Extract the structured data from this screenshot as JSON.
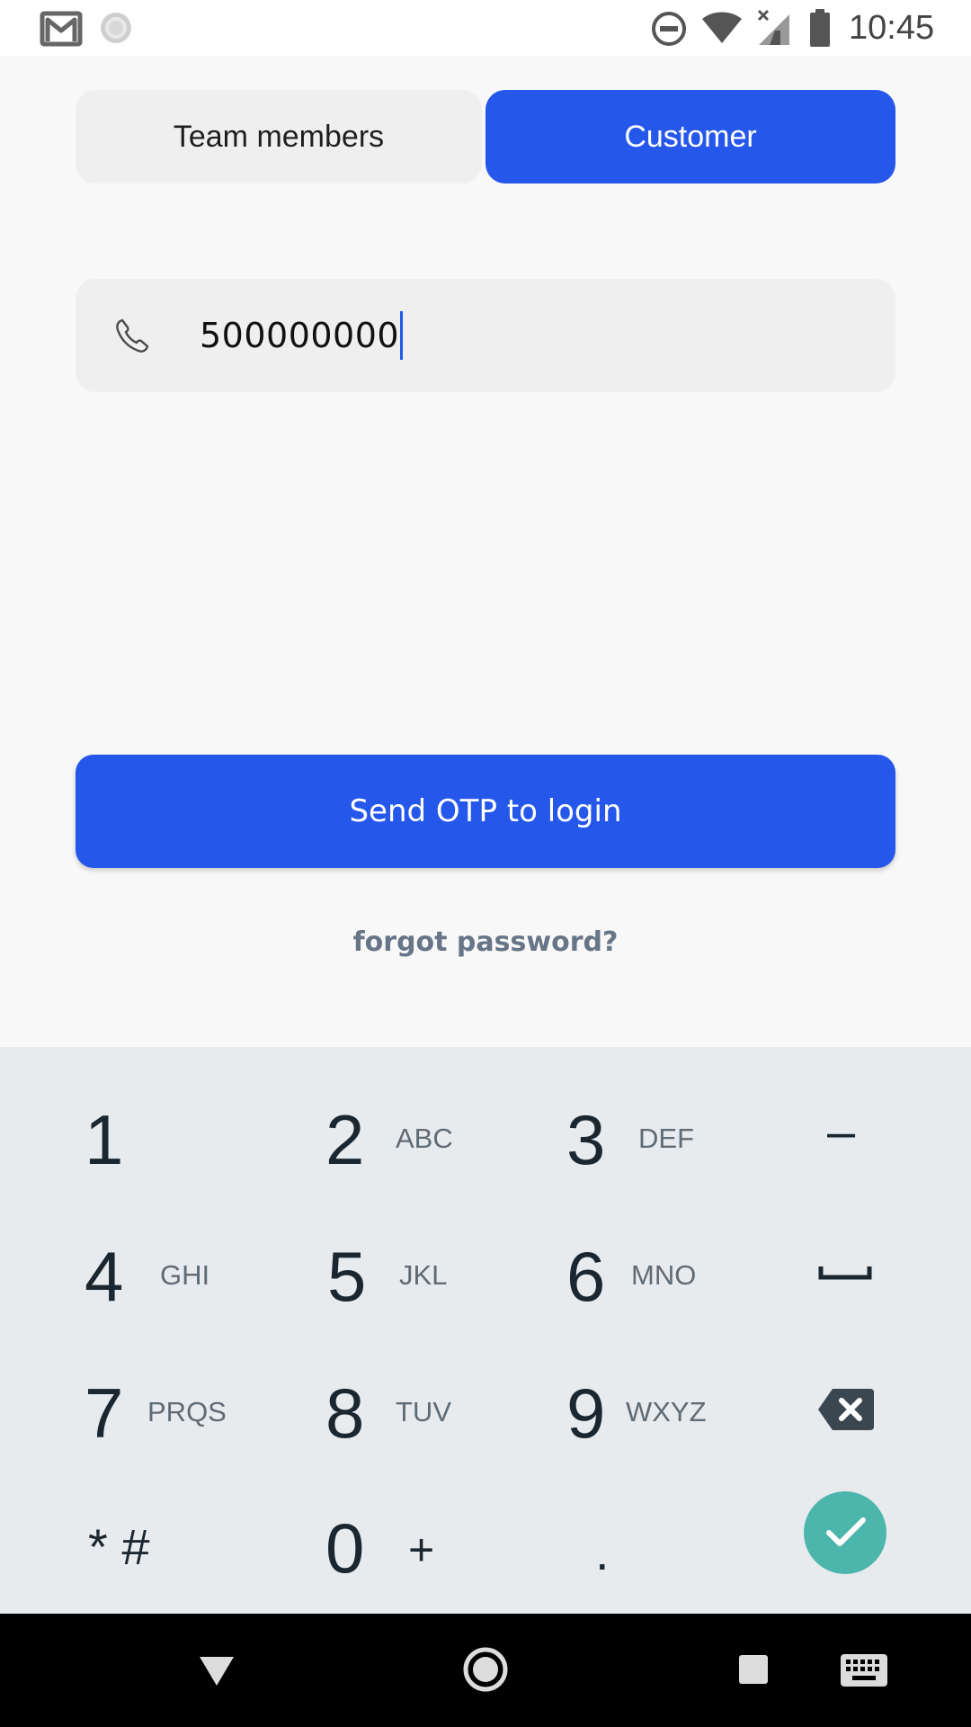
{
  "status_bar": {
    "time": "10:45",
    "icons": [
      "gmail-icon",
      "sync-icon",
      "do-not-disturb-icon",
      "wifi-icon",
      "cellular-no-signal-icon",
      "battery-icon"
    ]
  },
  "login_tabs": {
    "team_label": "Team members",
    "customer_label": "Customer",
    "selected": "Customer"
  },
  "phone_field": {
    "icon": "phone-icon",
    "value": "500000000"
  },
  "actions": {
    "send_otp_label": "Send OTP to login",
    "forgot_password_label": "forgot password?"
  },
  "keypad": {
    "keys": [
      {
        "digit": "1",
        "letters": ""
      },
      {
        "digit": "2",
        "letters": "ABC"
      },
      {
        "digit": "3",
        "letters": "DEF"
      },
      {
        "digit": "4",
        "letters": "GHI"
      },
      {
        "digit": "5",
        "letters": "JKL"
      },
      {
        "digit": "6",
        "letters": "MNO"
      },
      {
        "digit": "7",
        "letters": "PRQS"
      },
      {
        "digit": "8",
        "letters": "TUV"
      },
      {
        "digit": "9",
        "letters": "WXYZ"
      },
      {
        "digit": "0",
        "letters": "+"
      }
    ],
    "symbols": {
      "minus": "–",
      "star_hash": "* #",
      "period": "."
    },
    "icons": [
      "space-icon",
      "backspace-icon",
      "check-icon"
    ]
  },
  "navigation_bar": {
    "icons": [
      "back-icon",
      "home-icon",
      "recents-icon",
      "keyboard-icon"
    ]
  },
  "colors": {
    "accent": "#2557ea",
    "done_key": "#4db6ac",
    "keypad_bg": "#e8ebee",
    "forgot_text": "#667587"
  }
}
